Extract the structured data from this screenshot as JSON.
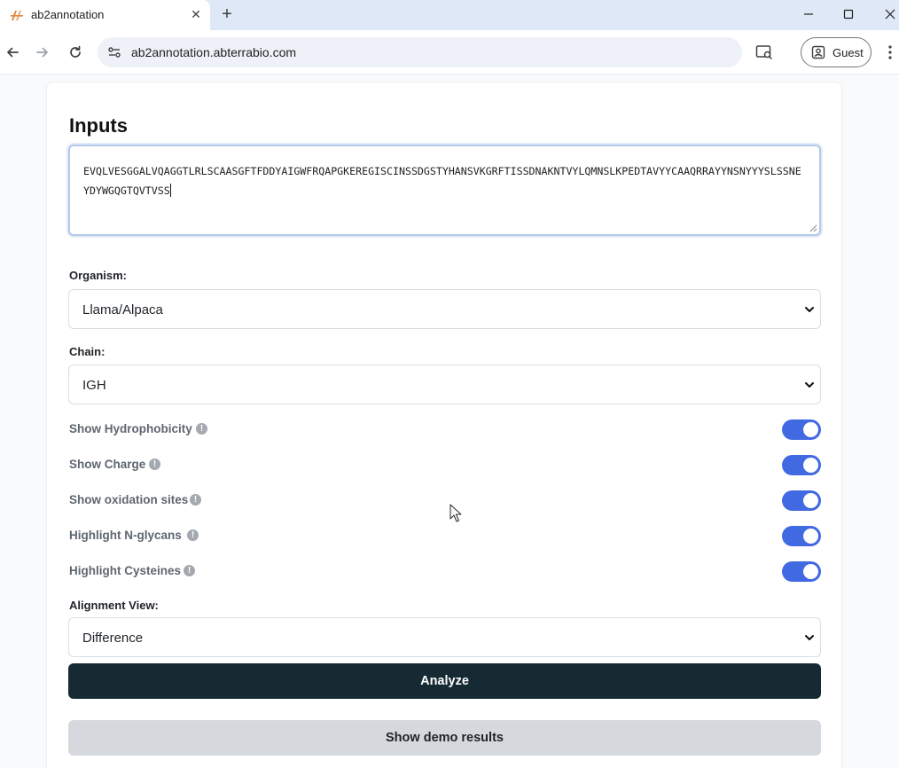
{
  "browser": {
    "tab_title": "ab2annotation",
    "url": "ab2annotation.abterrabio.com",
    "profile_label": "Guest"
  },
  "page": {
    "heading": "Inputs",
    "sequence": "EVQLVESGGALVQAGGTLRLSCAASGFTFDDYAIGWFRQAPGKEREGISCINSSDGSTYHANSVKGRFTISSDNAKNTVYLQMNSLKPEDTAVYYCAAQRRAYYNSNYYYSLSSNEYDYWGQGTQVTVSS",
    "organism": {
      "label": "Organism:",
      "value": "Llama/Alpaca"
    },
    "chain": {
      "label": "Chain:",
      "value": "IGH"
    },
    "toggles": [
      {
        "label": "Show Hydrophobicity",
        "on": true
      },
      {
        "label": "Show Charge",
        "on": true
      },
      {
        "label": "Show oxidation sites",
        "on": true
      },
      {
        "label": "Highlight N-glycans",
        "on": true
      },
      {
        "label": "Highlight Cysteines",
        "on": true
      }
    ],
    "alignment": {
      "label": "Alignment View:",
      "value": "Difference"
    },
    "analyze_label": "Analyze",
    "demo_label": "Show demo results"
  },
  "colors": {
    "toggle_on": "#4169e1",
    "analyze_bg": "#162a33",
    "demo_bg": "#d5d9de",
    "focus_border": "#b3c9ea"
  }
}
